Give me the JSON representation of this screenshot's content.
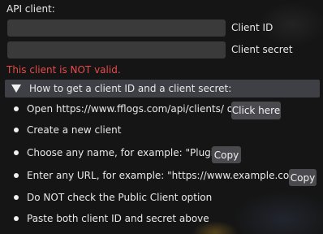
{
  "api": {
    "title": "API client:",
    "client_id_label": "Client ID",
    "client_id_value": "",
    "client_secret_label": "Client secret",
    "client_secret_value": "",
    "error_text": "This client is NOT valid."
  },
  "howto": {
    "header": "How to get a client ID and a client secret:",
    "steps": [
      {
        "text": "Open https://www.fflogs.com/api/clients/ or",
        "button": "Click here"
      },
      {
        "text": "Create a new client"
      },
      {
        "text": "Choose any name, for example: \"Plugin\"",
        "button": "Copy"
      },
      {
        "text": "Enter any URL, for example: \"https://www.example.com\"",
        "button": "Copy"
      },
      {
        "text": "Do NOT check the Public Client option"
      },
      {
        "text": "Paste both client ID and secret above"
      }
    ]
  },
  "colors": {
    "background": "#151515",
    "error": "#e84a4a",
    "header_bg": "#3f3f46",
    "button_bg": "#4a4a4e",
    "input_bg": "#3a3a3a"
  },
  "icons": {
    "collapse": "triangle-down-icon",
    "bullet": "bullet-icon"
  }
}
